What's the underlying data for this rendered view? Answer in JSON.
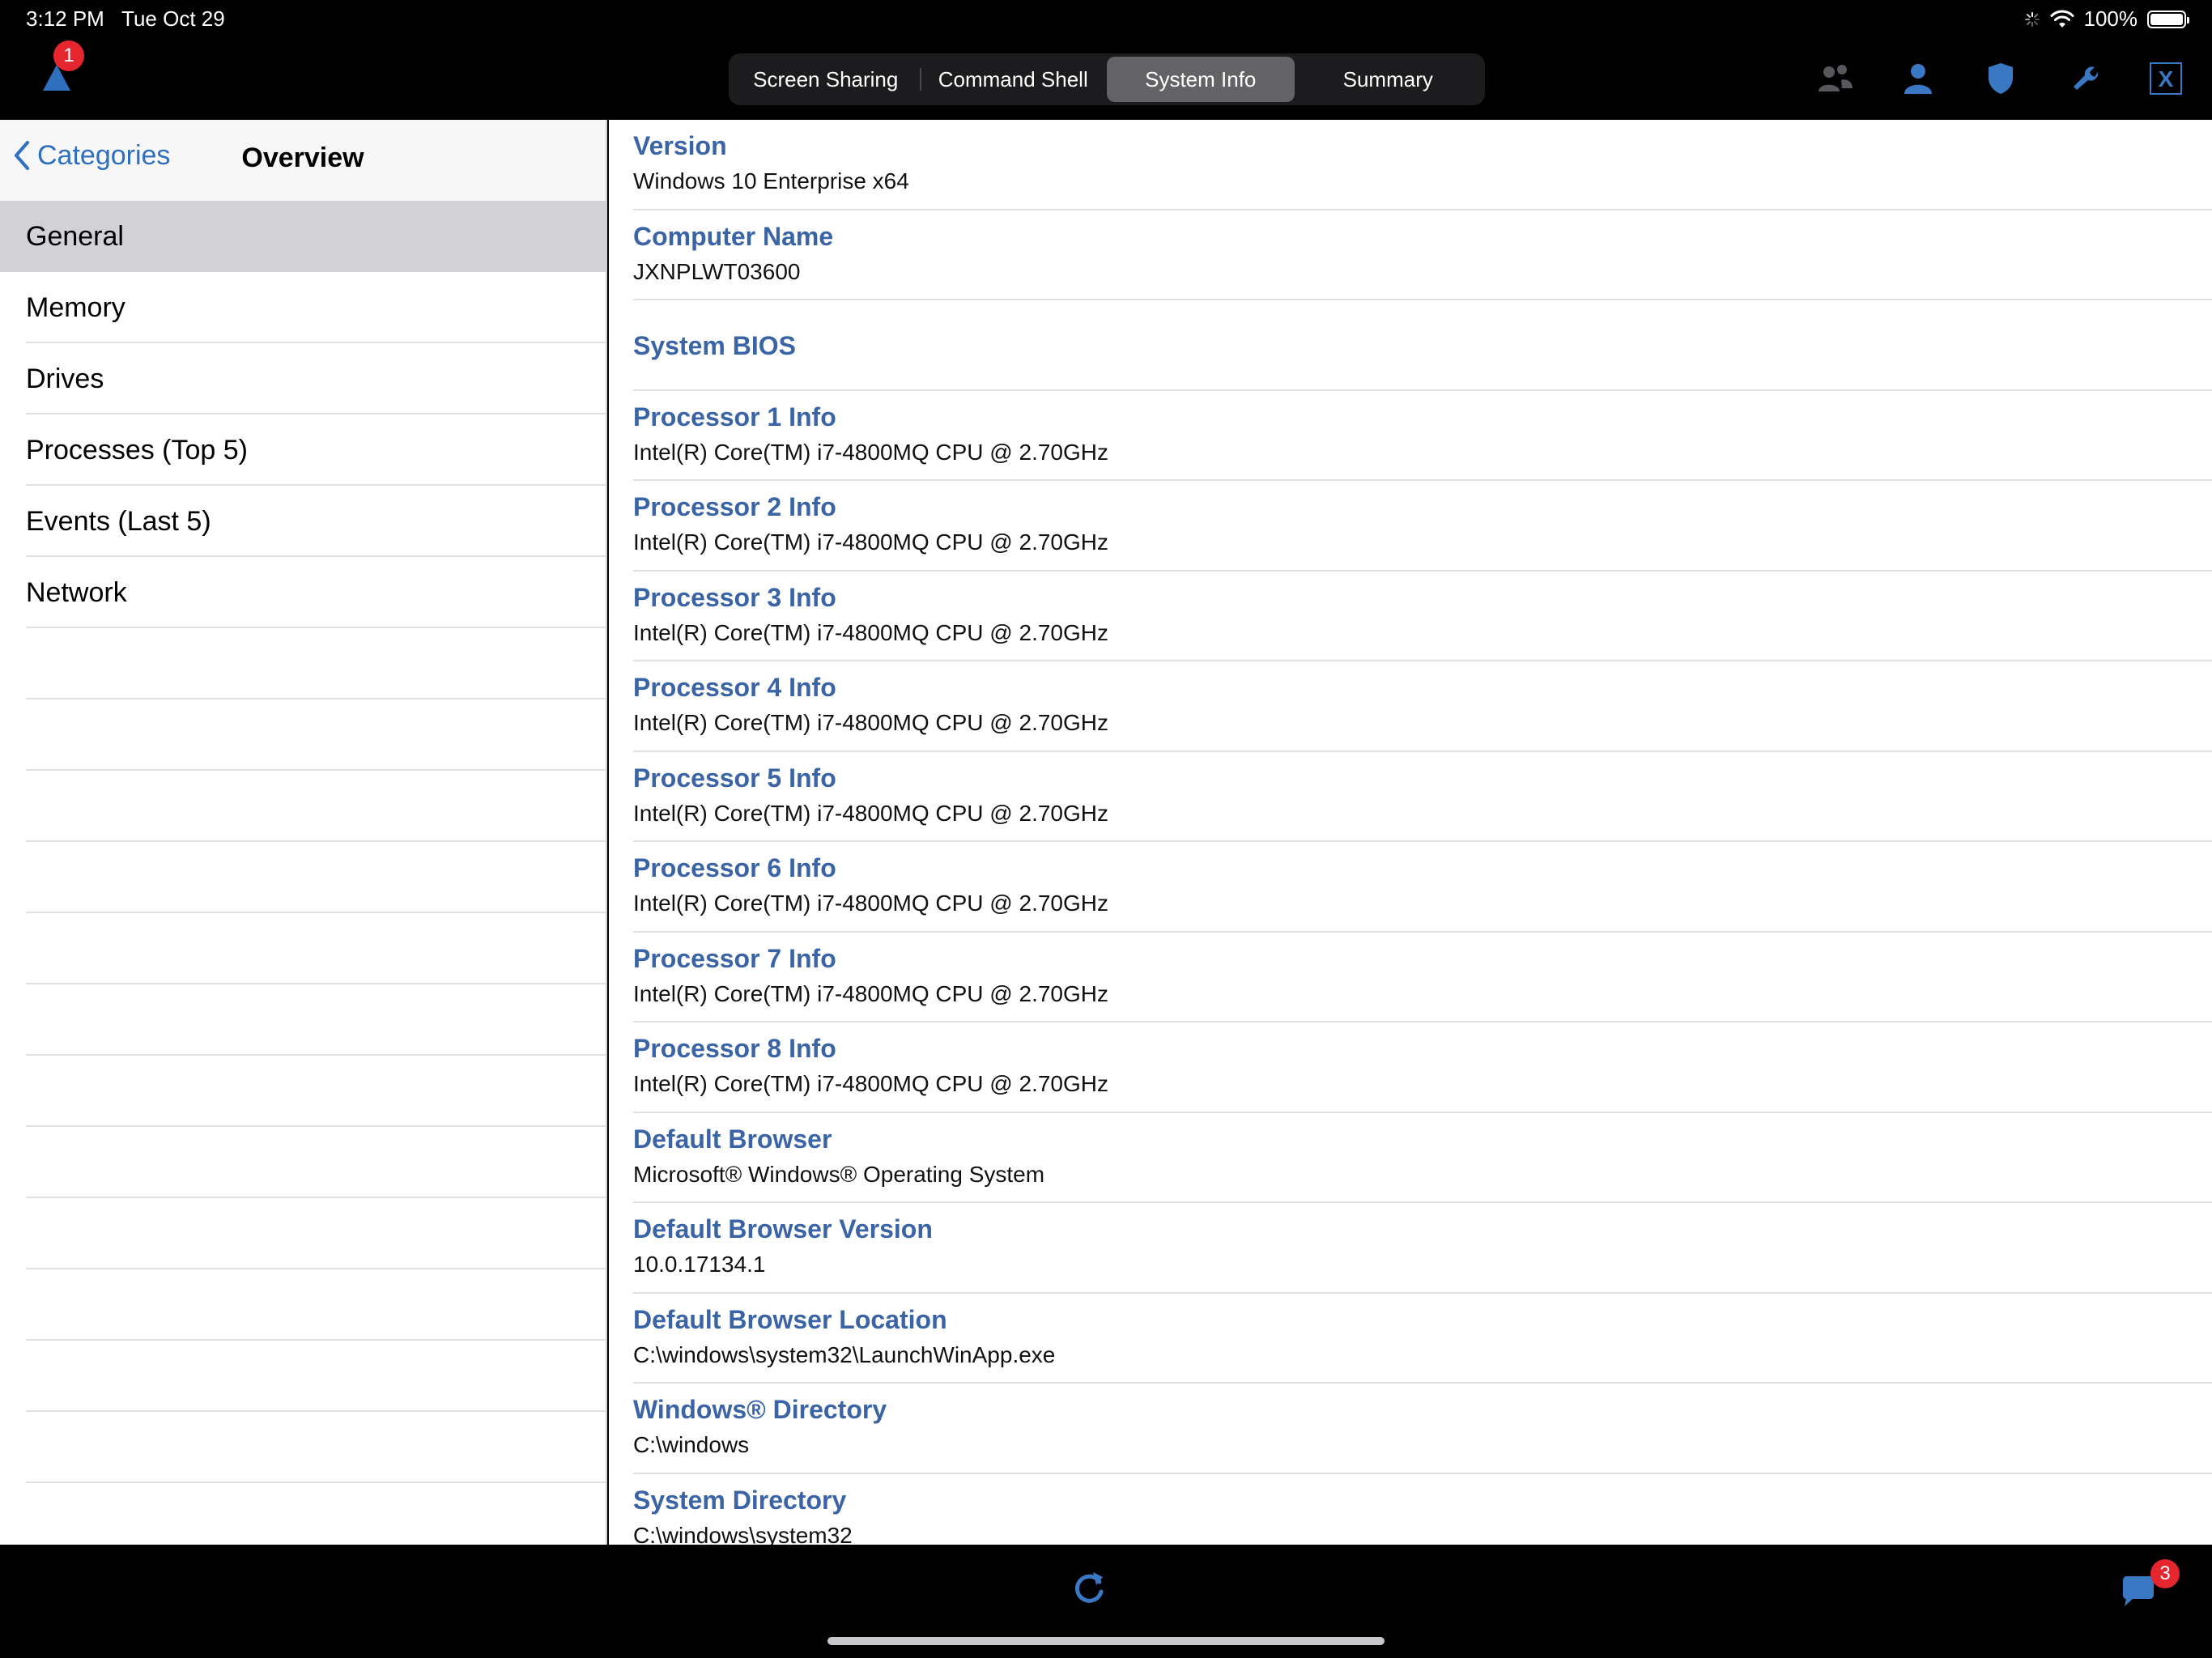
{
  "status_bar": {
    "time": "3:12 PM",
    "date": "Tue Oct 29",
    "battery": "100%",
    "battery_level": 1.0
  },
  "toolbar": {
    "alert_badge": "1",
    "tabs": [
      {
        "label": "Screen Sharing",
        "active": false
      },
      {
        "label": "Command Shell",
        "active": false
      },
      {
        "label": "System Info",
        "active": true
      },
      {
        "label": "Summary",
        "active": false
      }
    ],
    "close_label": "X",
    "icons": [
      "users-icon",
      "user-icon",
      "shield-icon",
      "wrench-icon",
      "close-x-icon"
    ]
  },
  "sidebar": {
    "back_label": "Categories",
    "title": "Overview",
    "items": [
      {
        "label": "General",
        "selected": true
      },
      {
        "label": "Memory",
        "selected": false
      },
      {
        "label": "Drives",
        "selected": false
      },
      {
        "label": "Processes (Top 5)",
        "selected": false
      },
      {
        "label": "Events (Last 5)",
        "selected": false
      },
      {
        "label": "Network",
        "selected": false
      }
    ]
  },
  "details": [
    {
      "label": "Version",
      "value": "Windows 10 Enterprise x64"
    },
    {
      "label": "Computer Name",
      "value": "JXNPLWT03600"
    },
    {
      "label": "System BIOS",
      "value": ""
    },
    {
      "label": "Processor 1 Info",
      "value": "Intel(R) Core(TM) i7-4800MQ CPU @ 2.70GHz"
    },
    {
      "label": "Processor 2 Info",
      "value": "Intel(R) Core(TM) i7-4800MQ CPU @ 2.70GHz"
    },
    {
      "label": "Processor 3 Info",
      "value": "Intel(R) Core(TM) i7-4800MQ CPU @ 2.70GHz"
    },
    {
      "label": "Processor 4 Info",
      "value": "Intel(R) Core(TM) i7-4800MQ CPU @ 2.70GHz"
    },
    {
      "label": "Processor 5 Info",
      "value": "Intel(R) Core(TM) i7-4800MQ CPU @ 2.70GHz"
    },
    {
      "label": "Processor 6 Info",
      "value": "Intel(R) Core(TM) i7-4800MQ CPU @ 2.70GHz"
    },
    {
      "label": "Processor 7 Info",
      "value": "Intel(R) Core(TM) i7-4800MQ CPU @ 2.70GHz"
    },
    {
      "label": "Processor 8 Info",
      "value": "Intel(R) Core(TM) i7-4800MQ CPU @ 2.70GHz"
    },
    {
      "label": "Default Browser",
      "value": "Microsoft® Windows® Operating System"
    },
    {
      "label": "Default Browser Version",
      "value": "10.0.17134.1"
    },
    {
      "label": "Default Browser Location",
      "value": "C:\\windows\\system32\\LaunchWinApp.exe"
    },
    {
      "label": "Windows® Directory",
      "value": "C:\\windows"
    },
    {
      "label": "System Directory",
      "value": "C:\\windows\\system32"
    }
  ],
  "bottom_bar": {
    "chat_badge": "3"
  },
  "colors": {
    "accent": "#3a64a6",
    "link": "#2f6fbf",
    "badge": "#e5262e",
    "selected_row": "#d1d1d6"
  }
}
